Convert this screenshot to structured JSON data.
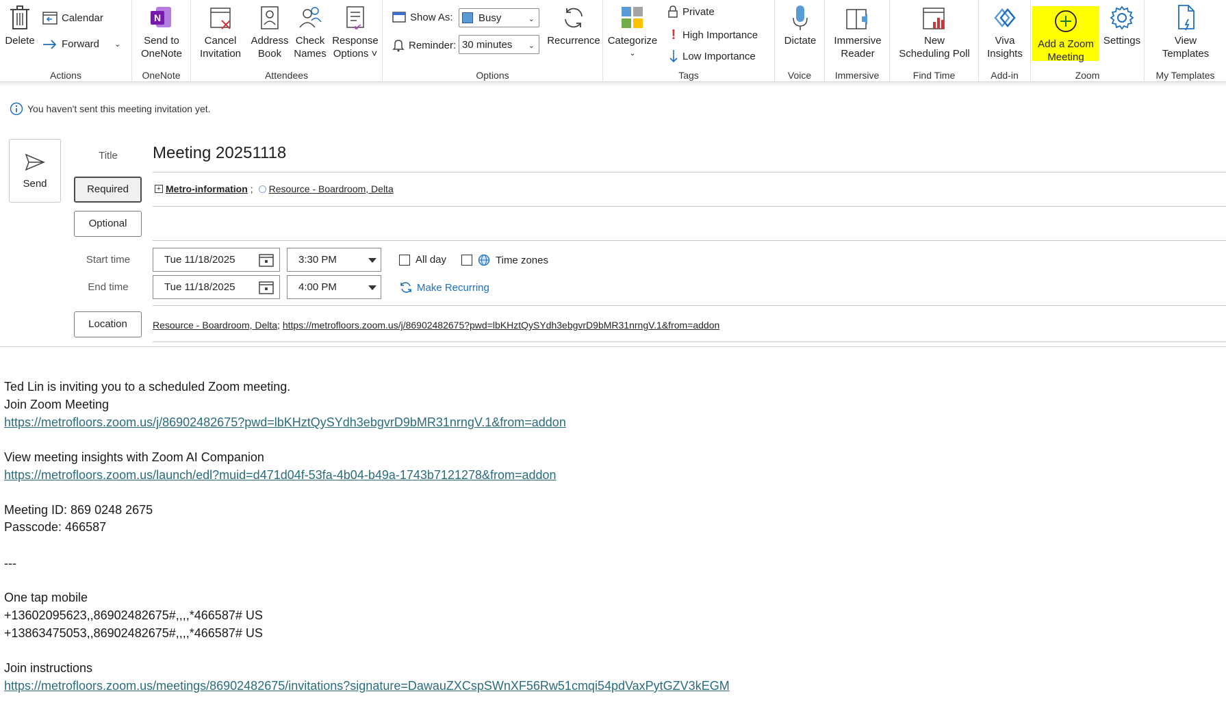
{
  "ribbon": {
    "actions": {
      "delete_label": "Delete",
      "calendar_label": "Calendar",
      "forward_label": "Forward",
      "group_label": "Actions"
    },
    "onenote": {
      "send_label_1": "Send to",
      "send_label_2": "OneNote",
      "group_label": "OneNote"
    },
    "attendees": {
      "cancel_1": "Cancel",
      "cancel_2": "Invitation",
      "address_1": "Address",
      "address_2": "Book",
      "check_1": "Check",
      "check_2": "Names",
      "response_1": "Response",
      "response_2": "Options ˅",
      "group_label": "Attendees"
    },
    "options": {
      "show_as_label": "Show As:",
      "show_as_value": "Busy",
      "reminder_label": "Reminder:",
      "reminder_value": "30 minutes",
      "recurrence_label": "Recurrence",
      "group_label": "Options"
    },
    "tags": {
      "categorize_label": "Categorize",
      "private_label": "Private",
      "high_label": "High Importance",
      "low_label": "Low Importance",
      "group_label": "Tags"
    },
    "voice": {
      "dictate_label": "Dictate",
      "group_label": "Voice"
    },
    "immersive": {
      "label_1": "Immersive",
      "label_2": "Reader",
      "group_label": "Immersive"
    },
    "findtime": {
      "label_1": "New",
      "label_2": "Scheduling Poll",
      "group_label": "Find Time"
    },
    "addin": {
      "label_1": "Viva",
      "label_2": "Insights",
      "group_label": "Add-in"
    },
    "zoom": {
      "add_1": "Add a Zoom",
      "add_2": "Meeting",
      "settings_label": "Settings",
      "group_label": "Zoom"
    },
    "templates": {
      "label_1": "View",
      "label_2": "Templates",
      "group_label": "My Templates"
    }
  },
  "info_bar": "You haven't sent this meeting invitation yet.",
  "form": {
    "send_label": "Send",
    "title_label": "Title",
    "title_value": "Meeting 20251118",
    "required_label": "Required",
    "optional_label": "Optional",
    "attendee_1": "Metro-information",
    "attendee_sep": ";",
    "attendee_2": "Resource - Boardroom, Delta",
    "start_label": "Start time",
    "start_date": "Tue 11/18/2025",
    "start_time": "3:30 PM",
    "end_label": "End time",
    "end_date": "Tue 11/18/2025",
    "end_time": "4:00 PM",
    "all_day_label": "All day",
    "time_zones_label": "Time zones",
    "make_recurring_label": "Make Recurring",
    "location_label": "Location",
    "location_part1": "Resource - Boardroom, Delta",
    "location_sep": "; ",
    "location_part2": "https://metrofloors.zoom.us/j/86902482675?pwd=lbKHztQySYdh3ebgvrD9bMR31nrngV.1&from=addon"
  },
  "body": {
    "line1": " Ted Lin is inviting you to a scheduled Zoom meeting.",
    "line2": "Join Zoom Meeting",
    "link1": "https://metrofloors.zoom.us/j/86902482675?pwd=lbKHztQySYdh3ebgvrD9bMR31nrngV.1&from=addon",
    "line3": "View meeting insights with Zoom AI Companion",
    "link2": "https://metrofloors.zoom.us/launch/edl?muid=d471d04f-53fa-4b04-b49a-1743b7121278&from=addon",
    "meeting_id": "Meeting ID: 869 0248 2675",
    "passcode": "Passcode: 466587",
    "divider": "---",
    "one_tap": "One tap mobile",
    "phone1": "+13602095623,,86902482675#,,,,*466587# US",
    "phone2": "+13863475053,,86902482675#,,,,*466587# US",
    "join_instructions": "Join instructions",
    "link3": "https://metrofloors.zoom.us/meetings/86902482675/invitations?signature=DawauZXCspSWnXF56Rw51cmqi54pdVaxPytGZV3kEGM"
  },
  "colors": {
    "zoom_highlight": "#ffff00",
    "link": "#2a6c7e",
    "accent_blue": "#1b6ec2",
    "onenote_purple": "#7719aa"
  }
}
